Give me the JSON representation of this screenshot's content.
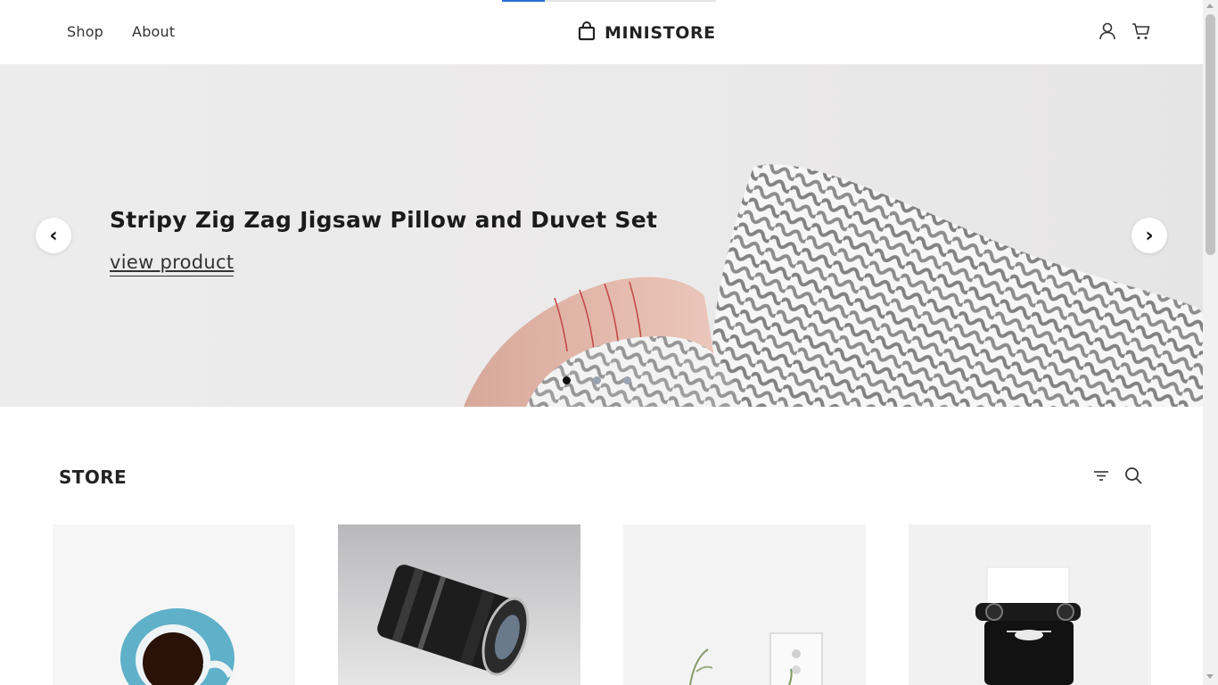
{
  "header": {
    "nav_left": [
      {
        "label": "Shop"
      },
      {
        "label": "About"
      }
    ],
    "brand": "MINISTORE",
    "icons": [
      "user-icon",
      "cart-icon",
      "shopping-bag-icon"
    ]
  },
  "hero": {
    "title": "Stripy Zig Zag Jigsaw Pillow and Duvet Set",
    "link": "view product",
    "prev_label": "‹",
    "next_label": "›",
    "slide_count": 3,
    "active_slide": 1
  },
  "store": {
    "title": "STORE",
    "tools": [
      "filter-icon",
      "search-icon"
    ]
  },
  "products": [
    {
      "image": "coffee-cup-image"
    },
    {
      "image": "camera-lens-image"
    },
    {
      "image": "plant-frame-image"
    },
    {
      "image": "typewriter-image"
    }
  ],
  "colors": {
    "accent": "#2b6fd6",
    "hero_bg": "#ebeaea",
    "text": "#222222"
  }
}
